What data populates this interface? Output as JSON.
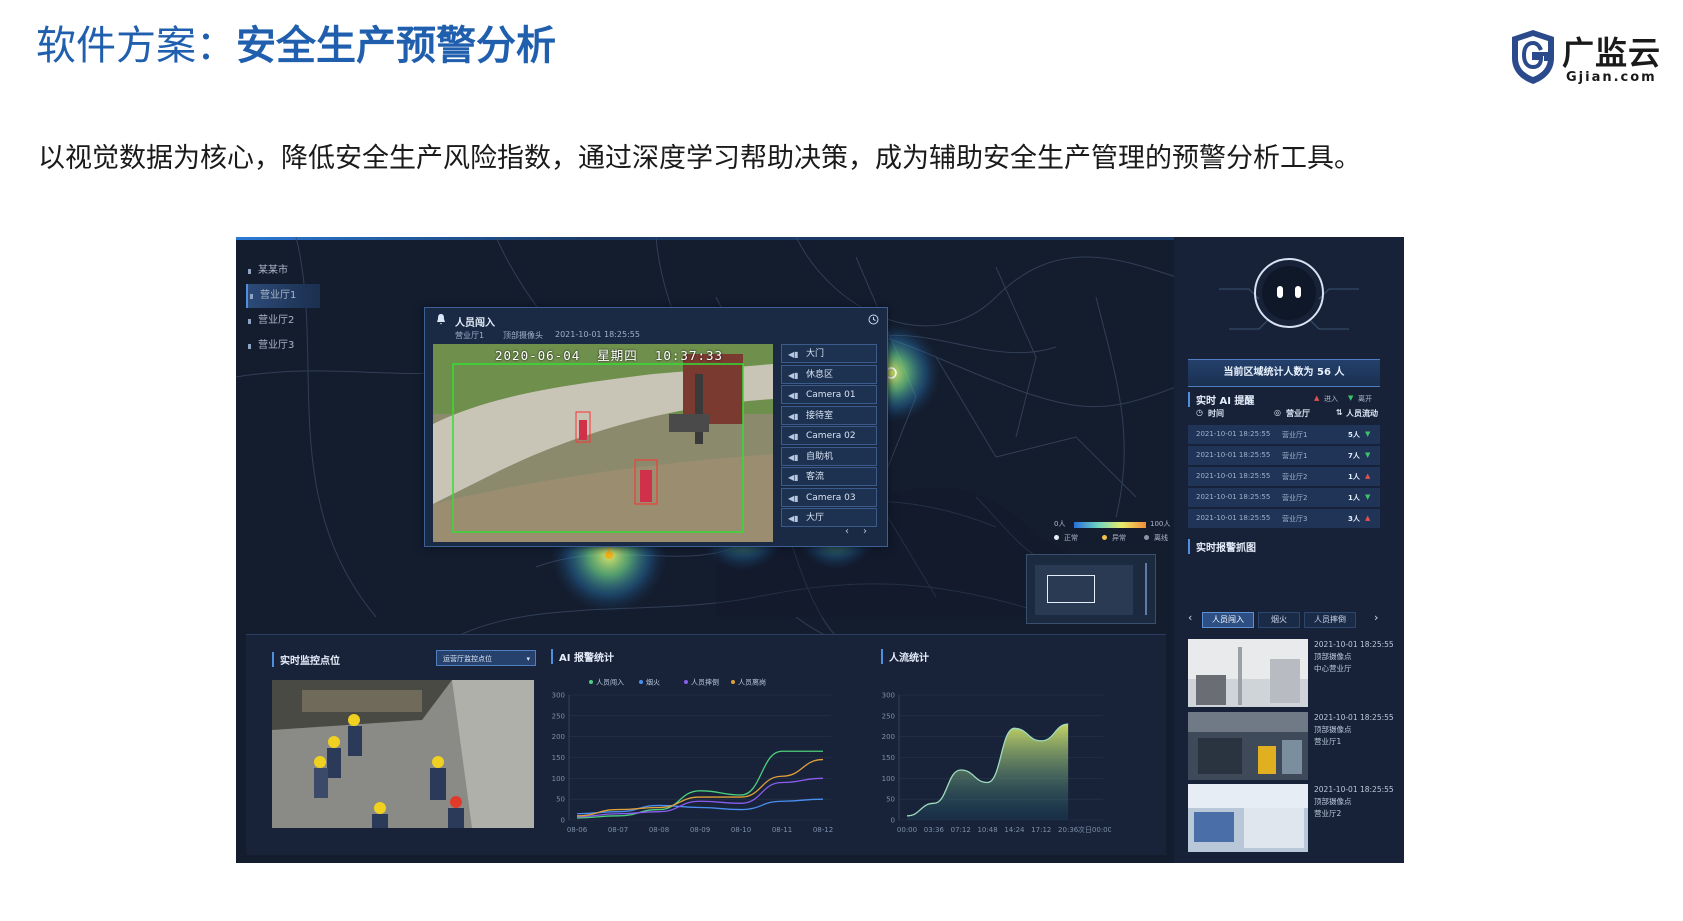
{
  "slide": {
    "title_prefix": "软件方案：",
    "title_main": "安全生产预警分析",
    "subtitle": "以视觉数据为核心，降低安全生产风险指数，通过深度学习帮助决策，成为辅助安全生产管理的预警分析工具。",
    "logo_text": "广监云",
    "logo_domain": "Gjian.com"
  },
  "dashboard": {
    "nav": [
      "某某市",
      "营业厅1",
      "营业厅2",
      "营业厅3"
    ],
    "alert_popup": {
      "title": "人员闯入",
      "location": "营业厅1",
      "camera": "顶部摄像头",
      "time": "2021-10-01 18:25:55",
      "video_timestamp": "2020-06-04  星期四  10:37:33",
      "cameras": [
        "大门",
        "休息区",
        "Camera 01",
        "接待室",
        "Camera 02",
        "自助机",
        "客流",
        "Camera 03",
        "大厅"
      ]
    },
    "heat_legend": {
      "min": "0人",
      "max": "100人",
      "status": [
        "正常",
        "异常",
        "离线"
      ],
      "status_colors": [
        "#e8eef8",
        "#f2c14e",
        "#8a95a8"
      ]
    },
    "right_panel": {
      "count_text": "当前区域统计人数为 56 人",
      "ai_title": "实时 AI 提醒",
      "ai_legend": [
        "进入",
        "离开"
      ],
      "ai_headers": [
        "时间",
        "营业厅",
        "人员流动"
      ],
      "ai_rows": [
        {
          "time": "2021-10-01 18:25:55",
          "hall": "营业厅1",
          "flow": "5人",
          "dir": "down"
        },
        {
          "time": "2021-10-01 18:25:55",
          "hall": "营业厅1",
          "flow": "7人",
          "dir": "down"
        },
        {
          "time": "2021-10-01 18:25:55",
          "hall": "营业厅2",
          "flow": "1人",
          "dir": "up"
        },
        {
          "time": "2021-10-01 18:25:55",
          "hall": "营业厅2",
          "flow": "1人",
          "dir": "down"
        },
        {
          "time": "2021-10-01 18:25:55",
          "hall": "营业厅3",
          "flow": "3人",
          "dir": "up"
        }
      ],
      "snap_title": "实时报警抓图",
      "snap_tabs": [
        "人员闯入",
        "烟火",
        "人员摔倒"
      ],
      "snaps": [
        {
          "time": "2021-10-01 18:25:55",
          "camera": "顶部摄像点",
          "hall": "中心营业厅"
        },
        {
          "time": "2021-10-01 18:25:55",
          "camera": "顶部摄像点",
          "hall": "营业厅1"
        },
        {
          "time": "2021-10-01 18:25:55",
          "camera": "顶部摄像点",
          "hall": "营业厅2"
        }
      ]
    },
    "bottom": {
      "monitor_title": "实时监控点位",
      "monitor_select": "运营厅监控点位",
      "ai_chart_title": "AI 报警统计",
      "flow_chart_title": "人流统计"
    }
  },
  "chart_data": [
    {
      "type": "line",
      "title": "AI 报警统计",
      "categories": [
        "08-06",
        "08-07",
        "08-08",
        "08-09",
        "08-10",
        "08-11",
        "08-12"
      ],
      "ylim": [
        0,
        300
      ],
      "yticks": [
        0,
        50,
        100,
        150,
        200,
        250,
        300
      ],
      "series": [
        {
          "name": "人员闯入",
          "color": "#4cd07d",
          "values": [
            5,
            10,
            25,
            70,
            60,
            165,
            165
          ]
        },
        {
          "name": "烟火",
          "color": "#4a8ff0",
          "values": [
            15,
            20,
            35,
            30,
            25,
            45,
            50
          ]
        },
        {
          "name": "人员摔倒",
          "color": "#8a5cf0",
          "values": [
            8,
            15,
            20,
            45,
            40,
            90,
            100
          ]
        },
        {
          "name": "人员离岗",
          "color": "#e0a13a",
          "values": [
            10,
            25,
            30,
            55,
            55,
            105,
            145
          ]
        }
      ]
    },
    {
      "type": "area",
      "title": "人流统计",
      "categories": [
        "00:00",
        "03:36",
        "07:12",
        "10:48",
        "14:24",
        "17:12",
        "20:36",
        "次日00:00"
      ],
      "ylim": [
        0,
        300
      ],
      "yticks": [
        0,
        50,
        100,
        150,
        200,
        250,
        300
      ],
      "series": [
        {
          "color": "#d8e86a",
          "values": [
            10,
            40,
            120,
            90,
            220,
            190,
            230
          ]
        }
      ]
    }
  ],
  "colors": {
    "accent": "#1f5fae",
    "panel": "#141d2e",
    "highlight": "#4f8fe0"
  }
}
